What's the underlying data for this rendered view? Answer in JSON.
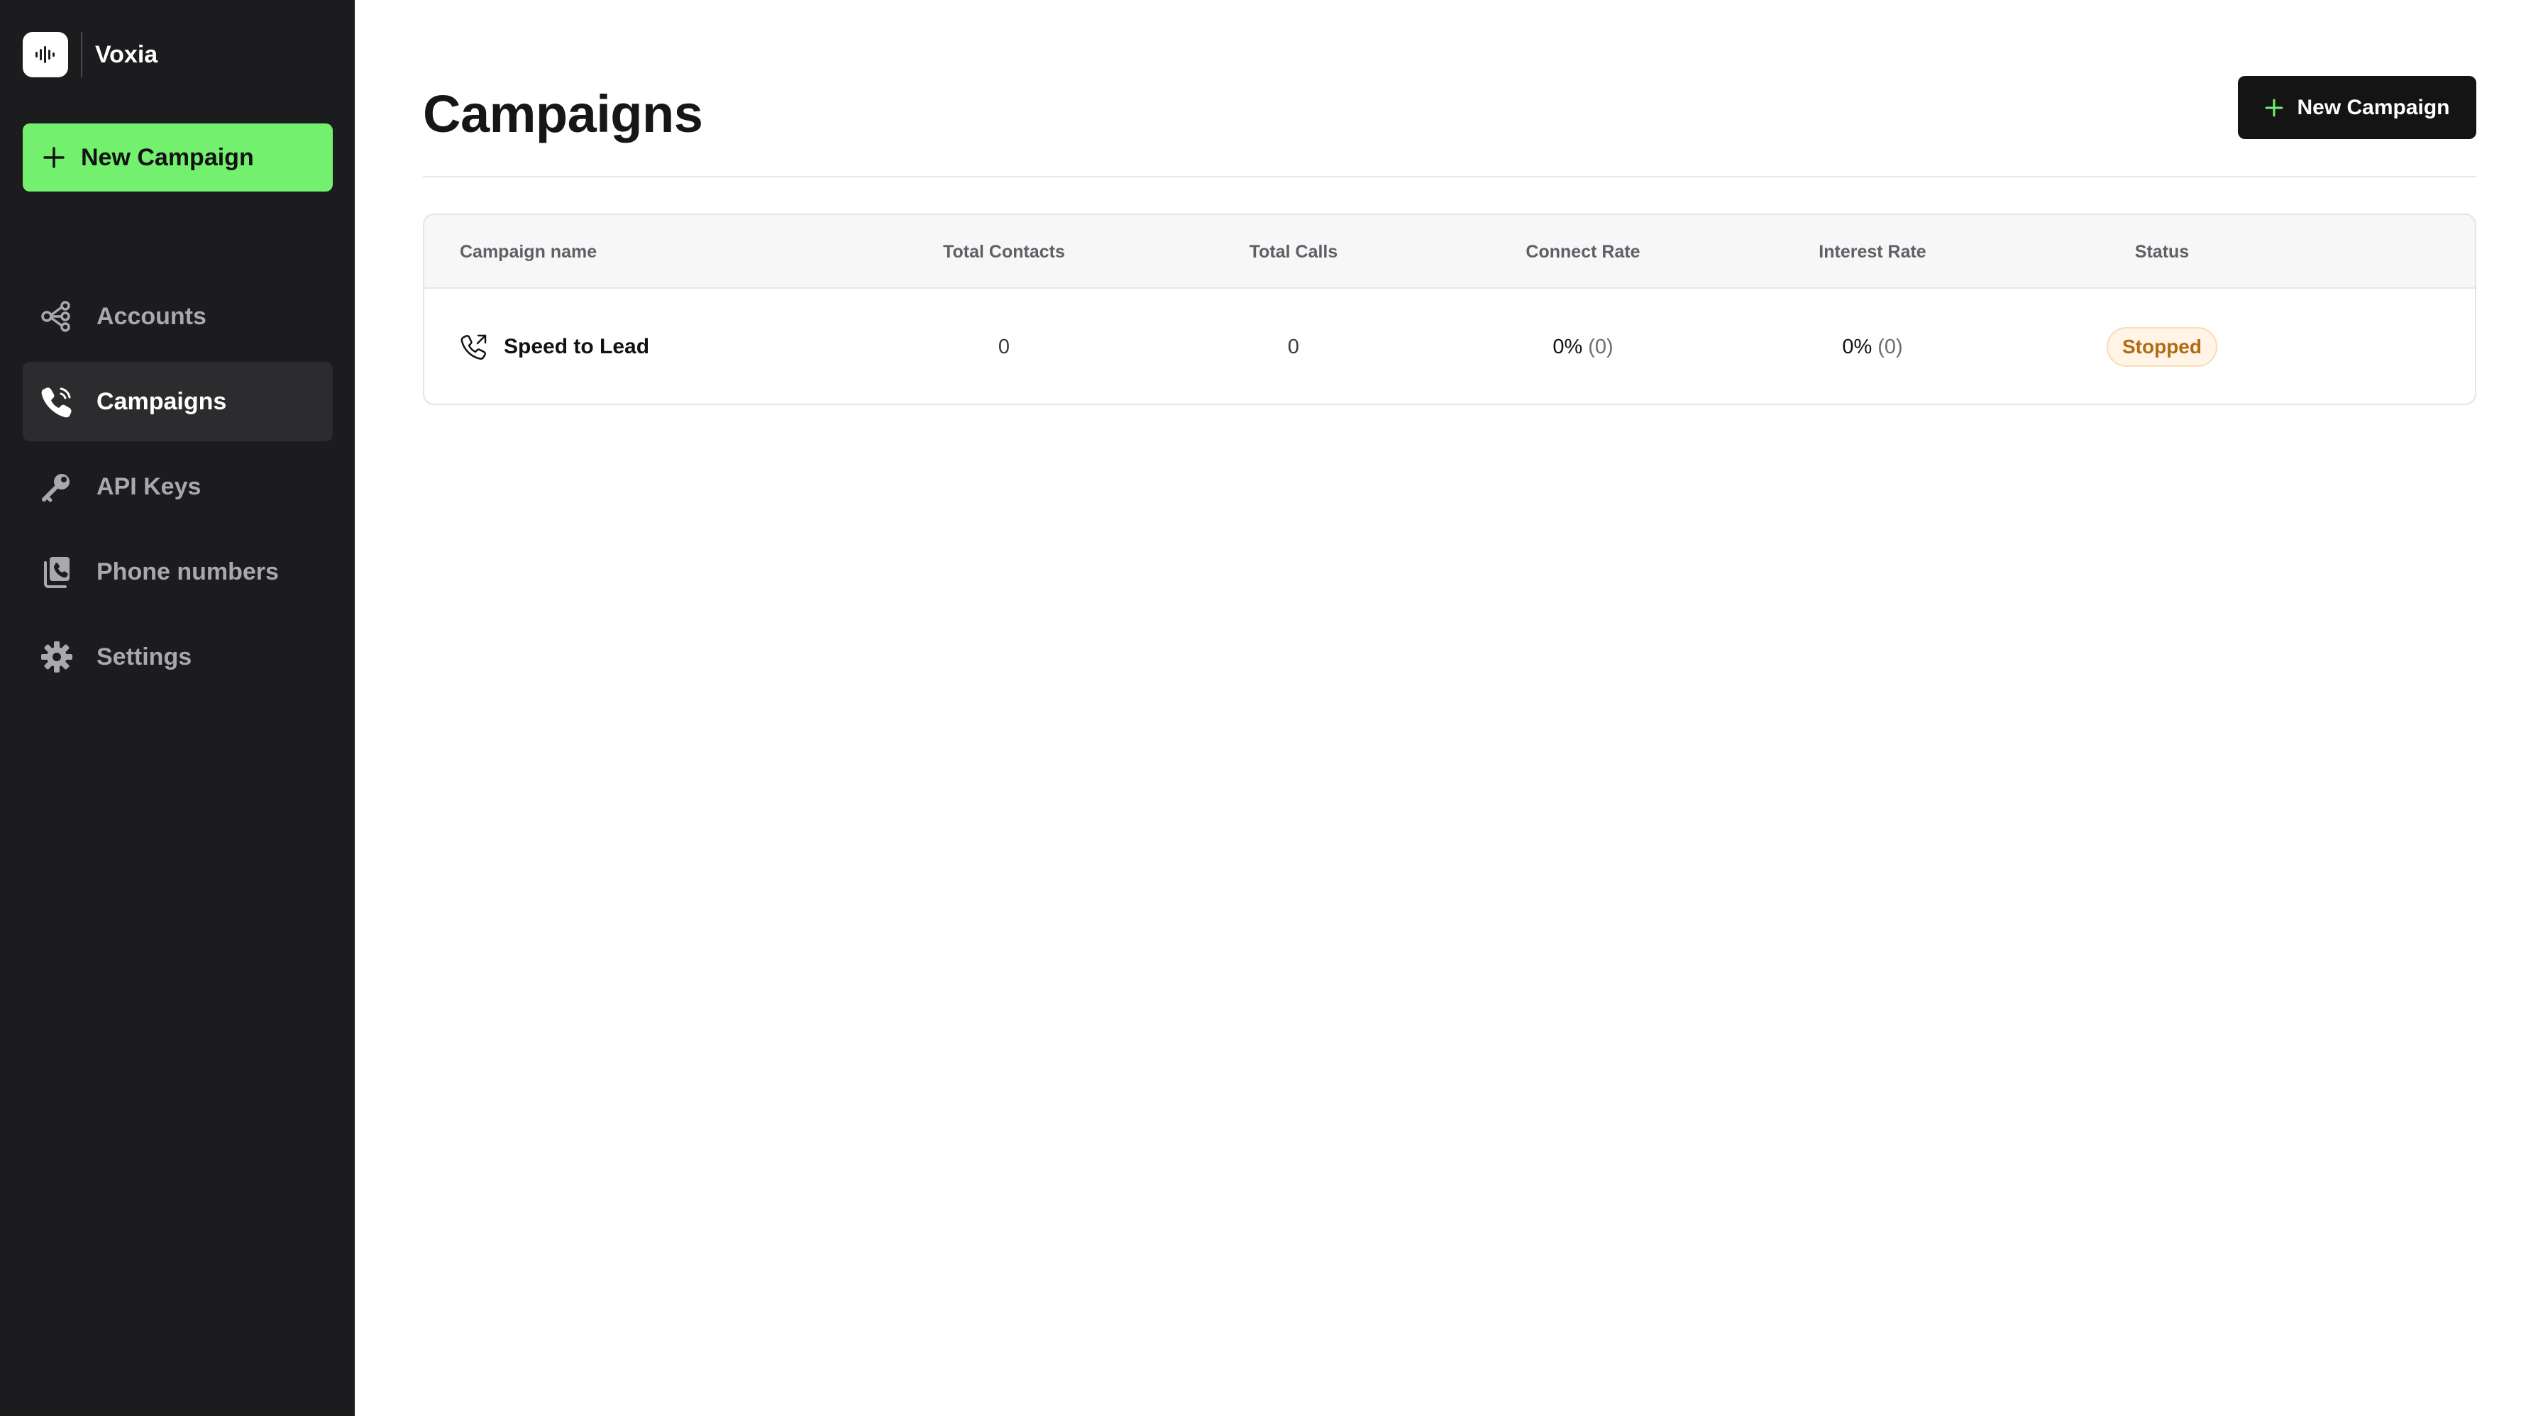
{
  "app": {
    "name": "Voxia"
  },
  "sidebar": {
    "new_campaign_label": "New Campaign",
    "items": [
      {
        "label": "Accounts",
        "icon": "accounts-icon",
        "active": false
      },
      {
        "label": "Campaigns",
        "icon": "phone-icon",
        "active": true
      },
      {
        "label": "API Keys",
        "icon": "key-icon",
        "active": false
      },
      {
        "label": "Phone numbers",
        "icon": "phone-numbers-icon",
        "active": false
      },
      {
        "label": "Settings",
        "icon": "gear-icon",
        "active": false
      }
    ]
  },
  "main": {
    "title": "Campaigns",
    "new_campaign_label": "New Campaign",
    "table": {
      "columns": [
        "Campaign name",
        "Total Contacts",
        "Total Calls",
        "Connect Rate",
        "Interest Rate",
        "Status"
      ],
      "rows": [
        {
          "name": "Speed to Lead",
          "total_contacts": "0",
          "total_calls": "0",
          "connect_rate": "0%",
          "connect_count": "(0)",
          "interest_rate": "0%",
          "interest_count": "(0)",
          "status": "Stopped"
        }
      ]
    }
  },
  "colors": {
    "sidebar_bg": "#1c1c1e",
    "accent_green": "#74f06f",
    "primary_button": "#141414",
    "status_stopped": "#b26b12"
  }
}
